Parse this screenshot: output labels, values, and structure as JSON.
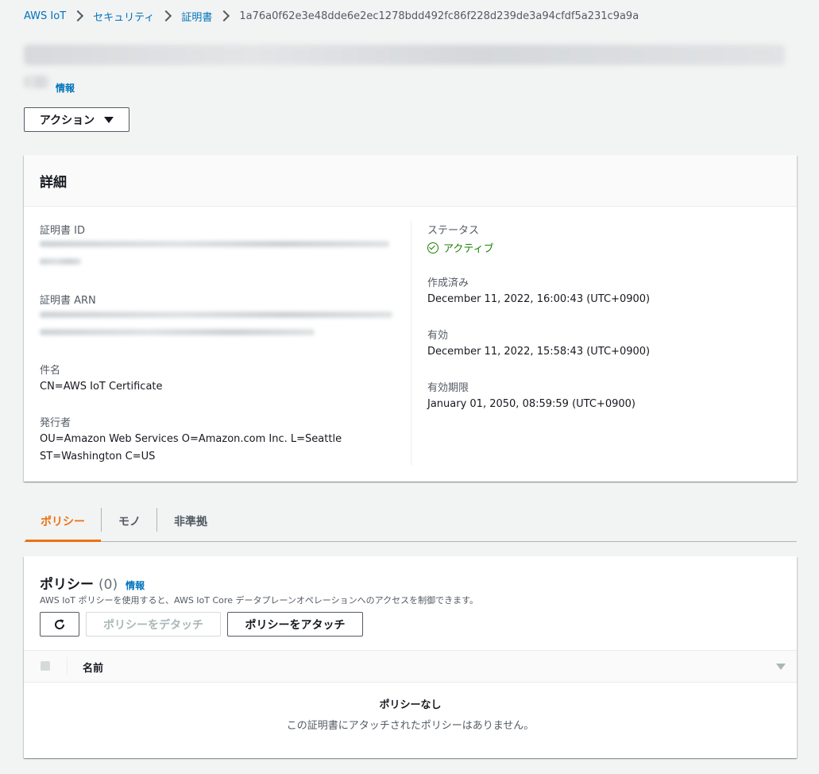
{
  "breadcrumb": {
    "items": [
      "AWS IoT",
      "セキュリティ",
      "証明書"
    ],
    "current": "1a76a0f62e3e48dde6e2ec1278bdd492fc86f228d239de3a94cfdf5a231c9a9a"
  },
  "header": {
    "info_label": "情報",
    "actions_label": "アクション"
  },
  "details": {
    "title": "詳細",
    "certificate_id_label": "証明書 ID",
    "certificate_arn_label": "証明書 ARN",
    "subject_label": "件名",
    "subject_value": "CN=AWS IoT Certificate",
    "issuer_label": "発行者",
    "issuer_line1": "OU=Amazon Web Services O=Amazon.com Inc. L=Seattle",
    "issuer_line2": "ST=Washington C=US",
    "status_label": "ステータス",
    "status_value": "アクティブ",
    "created_label": "作成済み",
    "created_value": "December 11, 2022, 16:00:43 (UTC+0900)",
    "valid_label": "有効",
    "valid_value": "December 11, 2022, 15:58:43 (UTC+0900)",
    "expires_label": "有効期限",
    "expires_value": "January 01, 2050, 08:59:59 (UTC+0900)"
  },
  "tabs": [
    {
      "label": "ポリシー",
      "active": true
    },
    {
      "label": "モノ",
      "active": false
    },
    {
      "label": "非準拠",
      "active": false
    }
  ],
  "policies": {
    "title": "ポリシー",
    "count": "(0)",
    "info_label": "情報",
    "description": "AWS IoT ポリシーを使用すると、AWS IoT Core データプレーンオペレーションへのアクセスを制御できます。",
    "detach_label": "ポリシーをデタッチ",
    "attach_label": "ポリシーをアタッチ",
    "column_name": "名前",
    "empty_title": "ポリシーなし",
    "empty_message": "この証明書にアタッチされたポリシーはありません。"
  },
  "colors": {
    "link": "#0073bb",
    "active_tab": "#ec7211",
    "success": "#1d8102"
  }
}
